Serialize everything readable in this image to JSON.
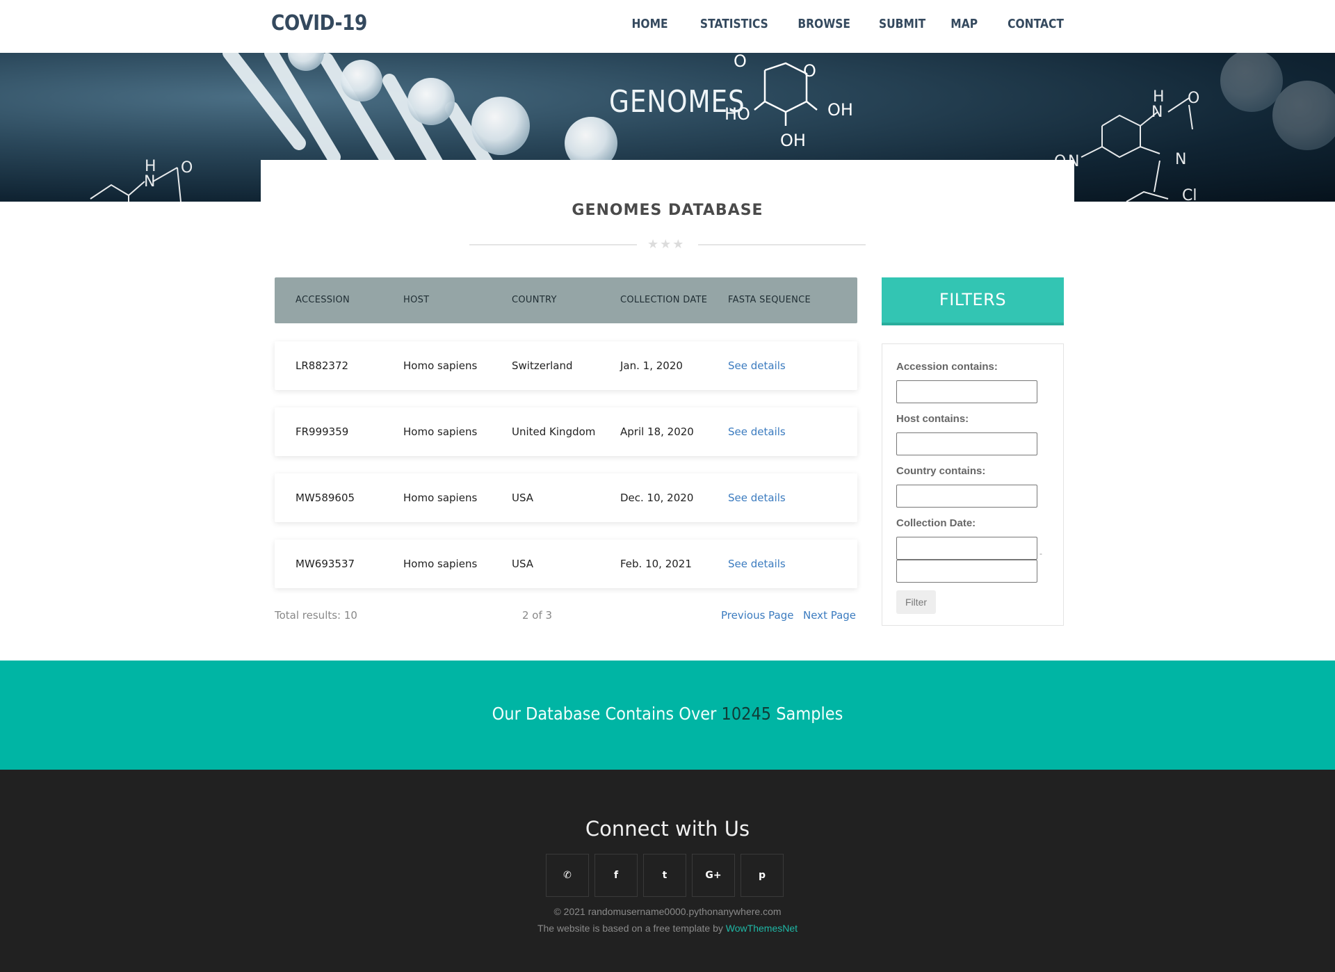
{
  "header": {
    "brand": "COVID-19",
    "nav": [
      "HOME",
      "STATISTICS",
      "BROWSE",
      "SUBMIT",
      "MAP",
      "CONTACT"
    ]
  },
  "hero": {
    "title": "GENOMES",
    "molecule_labels": [
      "O",
      "O",
      "HO",
      "OH",
      "OH",
      "H",
      "N",
      "O",
      "H",
      "N",
      "O",
      "N",
      "O",
      "N",
      "Cl"
    ]
  },
  "section": {
    "title": "GENOMES DATABASE"
  },
  "table": {
    "columns": [
      "ACCESSION",
      "HOST",
      "COUNTRY",
      "COLLECTION DATE",
      "FASTA SEQUENCE"
    ],
    "rows": [
      {
        "accession": "LR882372",
        "host": "Homo sapiens",
        "country": "Switzerland",
        "date": "Jan. 1, 2020",
        "link": "See details"
      },
      {
        "accession": "FR999359",
        "host": "Homo sapiens",
        "country": "United Kingdom",
        "date": "April 18, 2020",
        "link": "See details"
      },
      {
        "accession": "MW589605",
        "host": "Homo sapiens",
        "country": "USA",
        "date": "Dec. 10, 2020",
        "link": "See details"
      },
      {
        "accession": "MW693537",
        "host": "Homo sapiens",
        "country": "USA",
        "date": "Feb. 10, 2021",
        "link": "See details"
      }
    ],
    "total": "Total results: 10",
    "page": "2 of 3",
    "prev": "Previous Page",
    "next": "Next Page"
  },
  "filters": {
    "title": "FILTERS",
    "accession_label": "Accession contains:",
    "host_label": "Host contains:",
    "country_label": "Country contains:",
    "date_label": "Collection Date:",
    "date_separator": "-",
    "button": "Filter"
  },
  "banner": {
    "prefix": "Our Database Contains Over",
    "count": "10245",
    "suffix": "Samples"
  },
  "footer": {
    "heading": "Connect with Us",
    "socials": [
      {
        "icon": "phone-icon",
        "glyph": "✆"
      },
      {
        "icon": "facebook-icon",
        "glyph": "f"
      },
      {
        "icon": "twitter-icon",
        "glyph": "t"
      },
      {
        "icon": "google-plus-icon",
        "glyph": "G+"
      },
      {
        "icon": "pinterest-icon",
        "glyph": "p"
      }
    ],
    "copyright": "© 2021 randomusername0000.pythonanywhere.com",
    "credit_prefix": "The website is based on a free template by",
    "credit_link": "WowThemesNet"
  },
  "colors": {
    "header_text": "#34495e",
    "table_header": "#95a5a6",
    "link": "#3b7bbf",
    "filters_accent": "#33c5b3",
    "banner": "#00b5a4",
    "footer": "#212121"
  }
}
